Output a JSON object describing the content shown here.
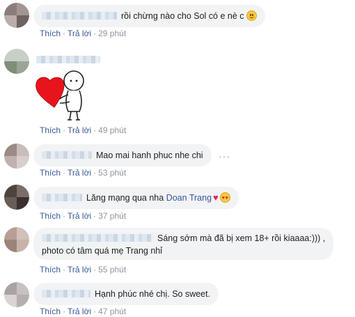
{
  "comments": [
    {
      "text": "rồi chừng nào cho Sol có e nè c",
      "emoji": "slightly-smiling-face-icon",
      "actions": {
        "like": "Thích",
        "reply": "Trả lời",
        "time": "29 phút"
      }
    },
    {
      "sticker": "heart-hug-sticker",
      "actions": {
        "like": "Thích",
        "reply": "Trả lời",
        "time": "49 phút"
      }
    },
    {
      "text": "Mao mai hanh phuc nhe chi",
      "actions": {
        "like": "Thích",
        "reply": "Trả lời",
        "time": "53 phút"
      }
    },
    {
      "text_before": "Lăng mạng qua nha",
      "mention": "Doan Trang",
      "emoji": "heart-eyes-icon",
      "actions": {
        "like": "Thích",
        "reply": "Trả lời",
        "time": "37 phút"
      }
    },
    {
      "line1": "Sáng sớm mà đã bị xem 18+ rồi kiaaaa:))) ,",
      "line2": "photo có tâm quá mẹ Trang nhỉ",
      "actions": {
        "like": "Thích",
        "reply": "Trả lời",
        "time": "55 phút"
      }
    },
    {
      "text": "Hạnh phúc nhé chị. So sweet.",
      "actions": {
        "like": "Thích",
        "reply": "Trả lời",
        "time": "47 phút"
      }
    }
  ],
  "colors": {
    "bubble": "#f2f3f5",
    "link": "#385898",
    "meta": "#90949c",
    "heart": "#e0245e"
  }
}
